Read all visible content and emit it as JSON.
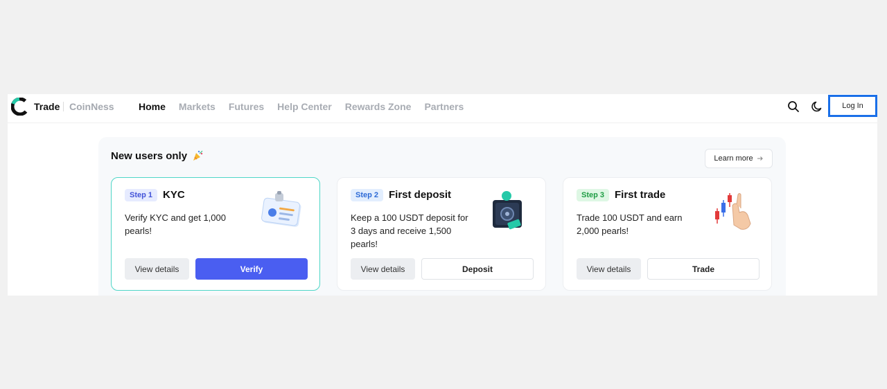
{
  "header": {
    "brand": "Trade",
    "brand_sub": "CoinNess",
    "nav": [
      "Home",
      "Markets",
      "Futures",
      "Help Center",
      "Rewards Zone",
      "Partners"
    ],
    "active_nav": "Home",
    "login_label": "Log In",
    "icons": [
      "search-icon",
      "moon-icon"
    ]
  },
  "panel": {
    "title": "New users only",
    "title_icon": "party-popper-icon",
    "learn_more": "Learn more",
    "learn_more_icon": "arrow-right-icon"
  },
  "cards": [
    {
      "step": "Step 1",
      "title": "KYC",
      "description": "Verify KYC and get 1,000 pearls!",
      "details_label": "View details",
      "action_label": "Verify",
      "illustration": "id-card-icon"
    },
    {
      "step": "Step 2",
      "title": "First deposit",
      "description": "Keep a 100 USDT deposit for 3 days and receive 1,500 pearls!",
      "details_label": "View details",
      "action_label": "Deposit",
      "illustration": "safe-icon"
    },
    {
      "step": "Step 3",
      "title": "First trade",
      "description": "Trade 100 USDT and earn 2,000 pearls!",
      "details_label": "View details",
      "action_label": "Trade",
      "illustration": "candlestick-hand-icon"
    }
  ],
  "colors": {
    "accent": "#4a5ef1",
    "login_border": "#1a6fe8",
    "active_card_border": "#4ed6c7"
  }
}
